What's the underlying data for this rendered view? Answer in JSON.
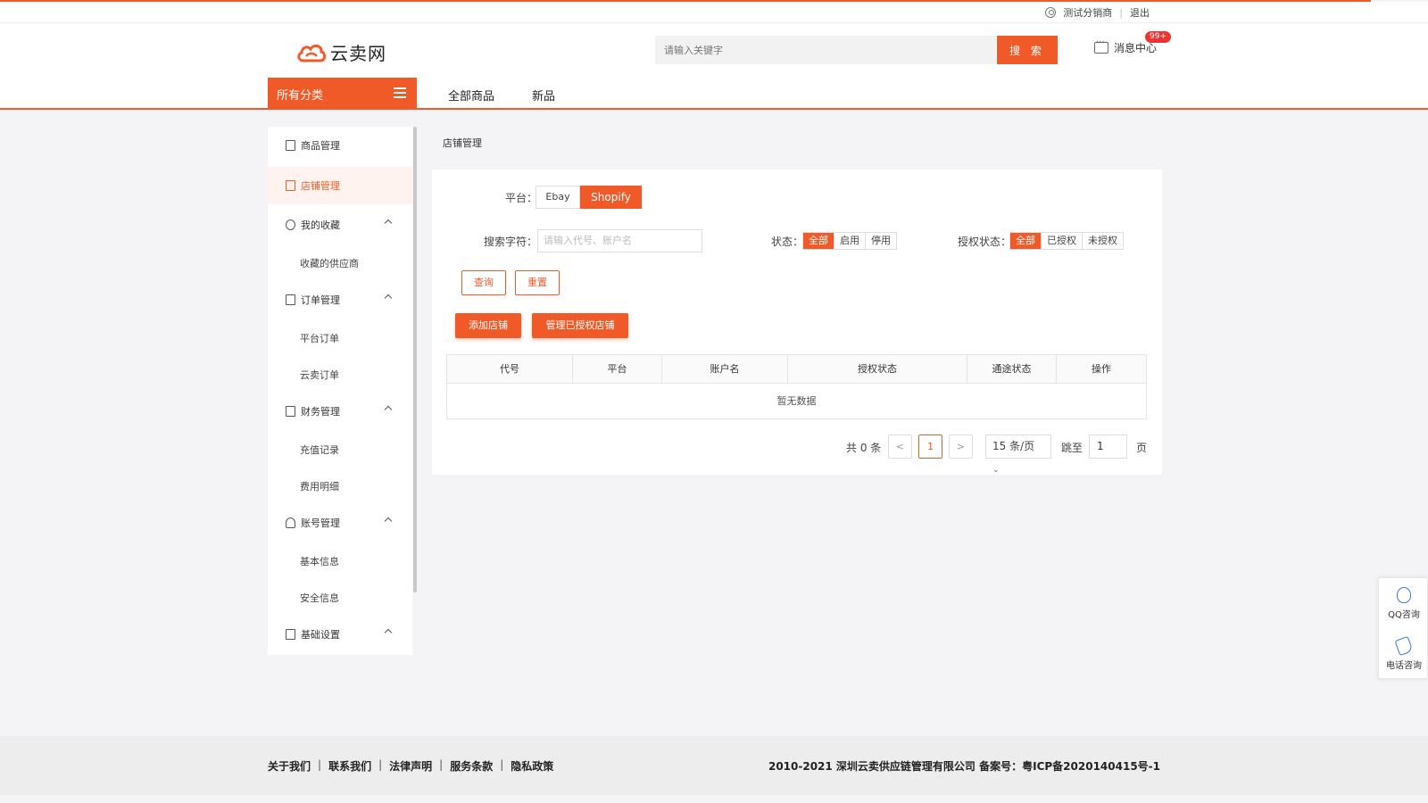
{
  "topbar": {
    "user_name": "测试分销商",
    "logout": "退出"
  },
  "header": {
    "logo_text": "云卖网",
    "search_placeholder": "请输入关键字",
    "search_button": "搜 索",
    "message_center": "消息中心",
    "message_badge": "99+"
  },
  "nav": {
    "category": "所有分类",
    "items": [
      "全部商品",
      "新品"
    ]
  },
  "sidebar": {
    "items": [
      {
        "label": "商品管理"
      },
      {
        "label": "店铺管理"
      },
      {
        "label": "我的收藏"
      },
      {
        "label": "收藏的供应商"
      },
      {
        "label": "订单管理"
      },
      {
        "label": "平台订单"
      },
      {
        "label": "云卖订单"
      },
      {
        "label": "财务管理"
      },
      {
        "label": "充值记录"
      },
      {
        "label": "费用明细"
      },
      {
        "label": "账号管理"
      },
      {
        "label": "基本信息"
      },
      {
        "label": "安全信息"
      },
      {
        "label": "基础设置"
      }
    ]
  },
  "main": {
    "breadcrumb": "店铺管理",
    "platform_label": "平台：",
    "platform_tabs": [
      "Ebay",
      "Shopify"
    ],
    "platform_selected": "Shopify",
    "search_label": "搜索字符：",
    "search_placeholder": "请输入代号、账户名",
    "status_label": "状态：",
    "status_options": [
      "全部",
      "启用",
      "停用"
    ],
    "auth_label": "授权状态：",
    "auth_options": [
      "全部",
      "已授权",
      "未授权"
    ],
    "query_button": "查询",
    "reset_button": "重置",
    "add_store_button": "添加店铺",
    "manage_button": "管理已授权店铺",
    "table_headers": [
      "代号",
      "平台",
      "账户名",
      "授权状态",
      "通途状态",
      "操作"
    ],
    "empty_text": "暂无数据",
    "pager": {
      "total": "共 0 条",
      "prev": "<",
      "current": "1",
      "next": ">",
      "page_size": "15 条/页",
      "jump_label": "跳至",
      "jump_value": "1",
      "page_suffix": "页"
    }
  },
  "float": {
    "qq": "QQ咨询",
    "phone": "电话咨询"
  },
  "footer": {
    "links": [
      "关于我们",
      "联系我们",
      "法律声明",
      "服务条款",
      "隐私政策"
    ],
    "copyright": "2010-2021 深圳云卖供应链管理有限公司   备案号：粤ICP备2020140415号-1"
  },
  "colors": {
    "accent": "#f05a28"
  }
}
